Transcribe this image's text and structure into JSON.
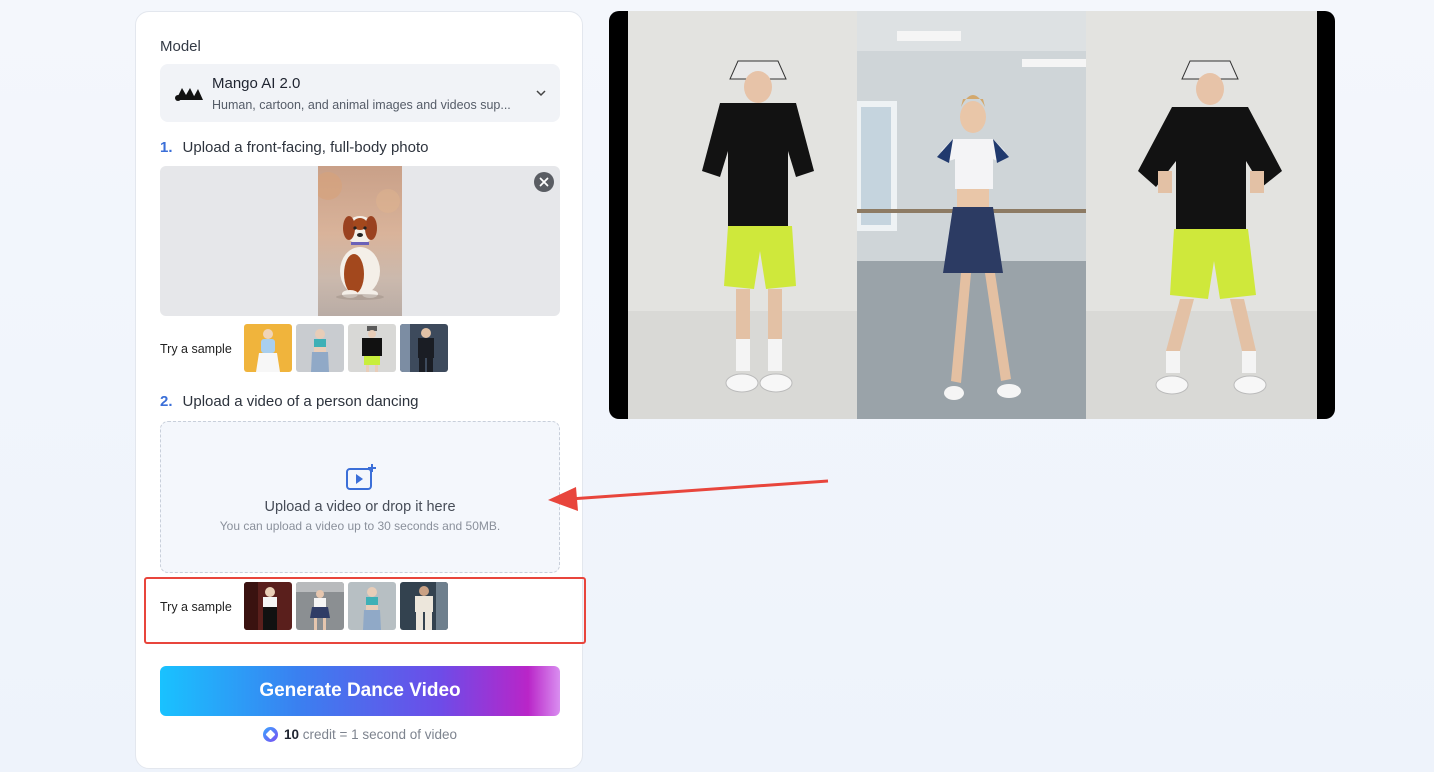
{
  "model": {
    "section_label": "Model",
    "name": "Mango AI 2.0",
    "description": "Human, cartoon, and animal images and videos sup..."
  },
  "step1": {
    "number": "1.",
    "label": "Upload a front-facing, full-body photo"
  },
  "photo_samples": {
    "label": "Try a sample",
    "count": 4
  },
  "step2": {
    "number": "2.",
    "label": "Upload a video of a person dancing"
  },
  "video_upload": {
    "title": "Upload a video or drop it here",
    "subtitle": "You can upload a video up to 30 seconds and 50MB."
  },
  "video_samples": {
    "label": "Try a sample",
    "count": 4
  },
  "generate_button": {
    "label": "Generate Dance Video"
  },
  "credit": {
    "amount": "10",
    "text": " credit = 1 second of video"
  },
  "colors": {
    "accent": "#3b6fd8",
    "highlight": "#e8453c",
    "gradient_start": "#19c2ff",
    "gradient_end": "#b925c8"
  },
  "icons": [
    "mango-logo-icon",
    "chevron-down-icon",
    "close-icon",
    "video-upload-icon",
    "credit-icon",
    "arrow-annotation-icon"
  ]
}
